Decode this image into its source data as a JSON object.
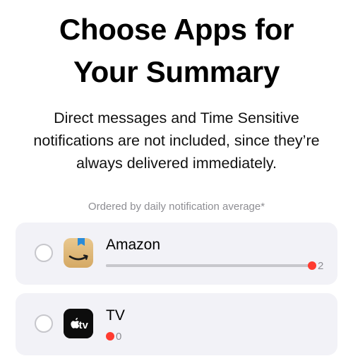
{
  "header": {
    "title_line1": "Choose Apps for",
    "title_line2": "Your Summary"
  },
  "description": {
    "line1": "Direct messages and Time Sensitive",
    "line2": "notifications are not included, since they’re",
    "line3": "always delivered immediately."
  },
  "list": {
    "caption": "Ordered by daily notification average*",
    "apps": [
      {
        "name": "Amazon",
        "count": "2",
        "fraction": 1.0,
        "icon": "amazon-app-icon",
        "selected": false
      },
      {
        "name": "TV",
        "count": "0",
        "fraction": 0.0,
        "icon": "apple-tv-app-icon",
        "selected": false
      }
    ]
  },
  "tv_icon_text": "tv",
  "colors": {
    "accent_red": "#ff3b30",
    "card_bg": "#f2f2f7",
    "caption_gray": "#8e8e93"
  }
}
